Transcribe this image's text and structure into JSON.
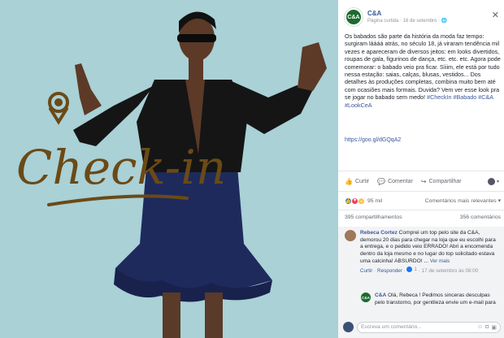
{
  "photo": {
    "overlay_text": "Check-in",
    "background_color": "#a9d1d6",
    "accent_color": "#6b4a16"
  },
  "post": {
    "page_name": "C&A",
    "avatar_text": "C&A",
    "meta": "Página curtida · 16 de setembro · ",
    "body": "Os babados são parte da história da moda faz tempo: surgiram láááá atrás, no século 18, já viraram tendência mil vezes e apareceram de diversos jeitos: em looks divertidos, roupas de gala, figurinos de dança, etc. etc. etc. Agora pode comemorar: o babado veio pra ficar. Sìiim, ele está por tudo nessa estação: saias, calças, blusas, vestidos... Dos detalhes às produções completas, combina muito bem até com ocasiões mais formais. Duvida? Vem ver esse look pra se jogar no babado sem medo! ",
    "hashtags": "#CheckIn #Babado #C&A #LookCeA",
    "link": "https://goo.gl/dGQqA2"
  },
  "actions": {
    "like": "Curtir",
    "comment": "Comentar",
    "share": "Compartilhar"
  },
  "reactions": {
    "count": "95 mil",
    "ranking": "Comentários mais relevantes ▾"
  },
  "stats": {
    "shares": "395 compartilhamentos",
    "views": "356 comentários"
  },
  "comments": [
    {
      "author": "Rebeca Cortez",
      "text": "Comprei um top pelo site da C&A, demorou 20 dias para chegar na loja que eu escolhi para a entrega, e o pedido veio ERRADO! Abri a encomenda dentro da loja mesmo e no lugar do top solicitado estava uma calcinha! ABSURDO!",
      "see_more": "Ver mais",
      "like": "Curtir",
      "reply": "Responder",
      "likes": "1",
      "time": "17 de setembro às 08:00"
    }
  ],
  "reply": {
    "author": "C&A",
    "avatar_text": "C&A",
    "text": "Olá, Rebeca ! Pedimos sinceras desculpas pelo transtorno, por gentileza envie um e-mail para"
  },
  "composer": {
    "placeholder": "Escreva um comentário..."
  },
  "icons": {
    "close": "close-icon",
    "like": "thumbs-up-icon",
    "comment": "speech-bubble-icon",
    "share": "share-arrow-icon"
  }
}
